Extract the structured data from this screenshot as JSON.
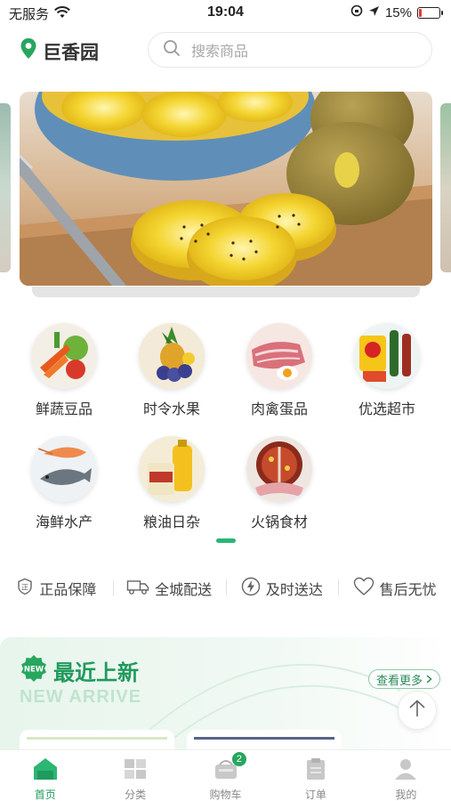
{
  "status_bar": {
    "carrier": "无服务",
    "time": "19:04",
    "battery": "15%",
    "battery_level": 0.15,
    "icons": [
      "wifi-icon",
      "screen-lock-icon",
      "location-arrow-icon",
      "battery-icon"
    ]
  },
  "header": {
    "location_name": "巨香园",
    "search_placeholder": "搜索商品"
  },
  "categories": [
    {
      "label": "鲜蔬豆品",
      "icon": "vegetables-image"
    },
    {
      "label": "时令水果",
      "icon": "fruit-image"
    },
    {
      "label": "肉禽蛋品",
      "icon": "meat-egg-image"
    },
    {
      "label": "优选超市",
      "icon": "snacks-drinks-image"
    },
    {
      "label": "海鲜水产",
      "icon": "seafood-image"
    },
    {
      "label": "粮油日杂",
      "icon": "grain-oil-image"
    },
    {
      "label": "火锅食材",
      "icon": "hotpot-image"
    }
  ],
  "guarantees": [
    {
      "label": "正品保障",
      "icon": "shield-icon"
    },
    {
      "label": "全城配送",
      "icon": "truck-icon"
    },
    {
      "label": "及时送达",
      "icon": "lightning-icon"
    },
    {
      "label": "售后无忧",
      "icon": "heart-icon"
    }
  ],
  "new_arrival": {
    "badge": "NEW",
    "title": "最近上新",
    "subtitle": "NEW ARRIVE",
    "more": "查看更多"
  },
  "tabbar": {
    "items": [
      {
        "label": "首页",
        "icon": "home-icon",
        "active": true
      },
      {
        "label": "分类",
        "icon": "category-icon",
        "active": false
      },
      {
        "label": "购物车",
        "icon": "cart-icon",
        "active": false
      },
      {
        "label": "订单",
        "icon": "order-icon",
        "active": false
      },
      {
        "label": "我的",
        "icon": "profile-icon",
        "active": false
      }
    ],
    "cart_badge": "2"
  },
  "colors": {
    "brand_green": "#1f9a5c",
    "battery_low": "#e53935"
  }
}
